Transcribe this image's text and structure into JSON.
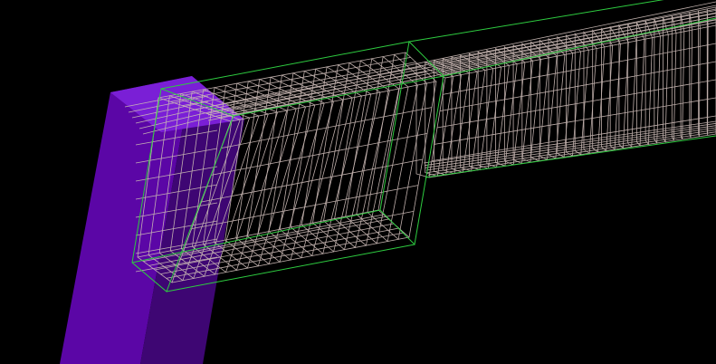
{
  "viewport": {
    "background": "#000000",
    "objects": [
      {
        "name": "concrete-column",
        "kind": "solid",
        "colors": {
          "front": "#5B06A6",
          "side": "#3E0673",
          "top": "#7A1FD6"
        }
      },
      {
        "name": "beam-outline",
        "kind": "wireframe",
        "color": "#2ECC40"
      },
      {
        "name": "rebar-cage",
        "kind": "wireframe",
        "color": "#C9B8B4"
      }
    ]
  }
}
